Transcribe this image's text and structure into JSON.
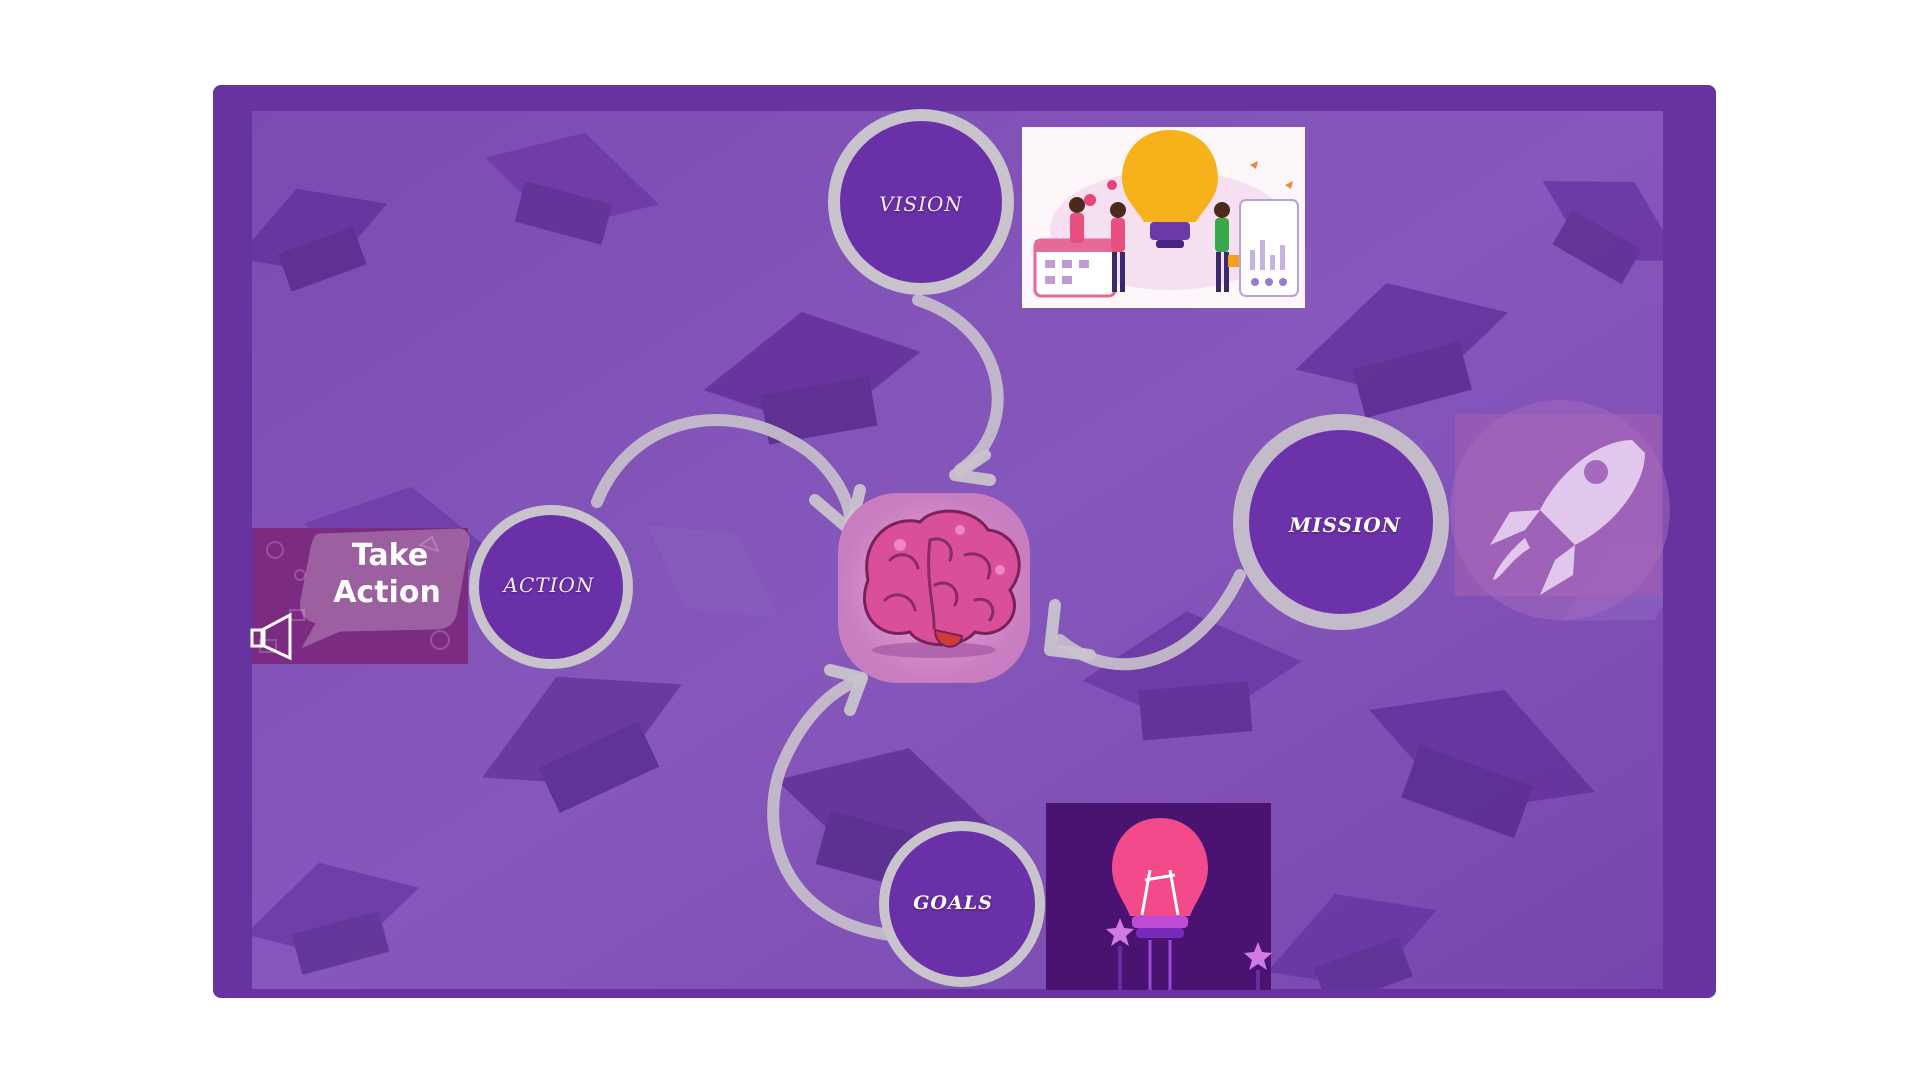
{
  "diagram": {
    "nodes": {
      "vision": {
        "label": "VISION"
      },
      "action": {
        "label": "ACTION"
      },
      "mission": {
        "label": "MISSION"
      },
      "goals": {
        "label": "GOALS"
      }
    },
    "images": {
      "take_action": {
        "line1": "Take",
        "line2": "Action",
        "icon": "megaphone-speech-bubble"
      },
      "vision_illustration": {
        "icon": "lightbulb-team-illustration"
      },
      "rocket": {
        "icon": "rocket-icon"
      },
      "goals_bulb": {
        "icon": "neon-lightbulb-icon"
      },
      "center": {
        "icon": "brain-icon"
      }
    },
    "background": {
      "pattern": "graduation-caps"
    }
  },
  "colors": {
    "frame": "#6633a0",
    "canvas": "#7a4bb0",
    "ring": "#c9c3cc",
    "node_fill": "#6a30a8",
    "brain_pink": "#d94f9a"
  }
}
